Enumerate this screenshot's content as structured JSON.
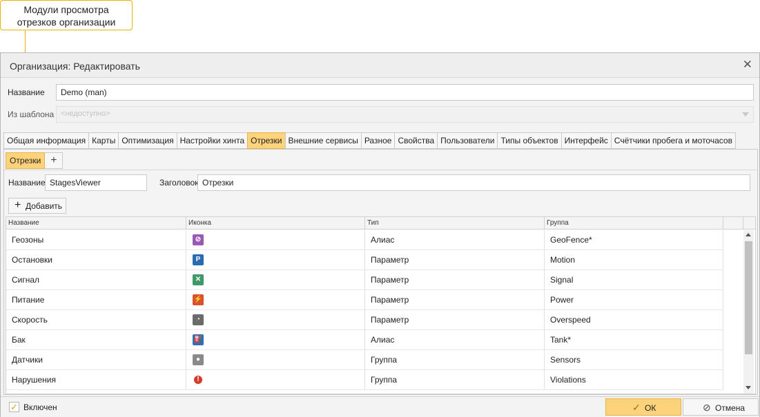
{
  "callout": {
    "text_line1": "Модули просмотра",
    "text_line2": "отрезков организации"
  },
  "dialog": {
    "title": "Организация: Редактировать",
    "name_label": "Название",
    "name_value": "Demo (man)",
    "template_label": "Из шаблона",
    "template_value": "<недоступно>"
  },
  "tabs": [
    "Общая информация",
    "Карты",
    "Оптимизация",
    "Настройки хинта",
    "Отрезки",
    "Внешние сервисы",
    "Разное",
    "Свойства",
    "Пользователи",
    "Типы объектов",
    "Интерфейс",
    "Счётчики пробега и моточасов"
  ],
  "active_tab": "Отрезки",
  "subtabs": {
    "active": "Отрезки",
    "add": "+"
  },
  "segment": {
    "name_label": "Название",
    "name_value": "StagesViewer",
    "header_label": "Заголовок",
    "header_value": "Отрезки"
  },
  "toolbar": {
    "add_label": "Добавить",
    "add_icon": "+"
  },
  "grid": {
    "columns": [
      "Название",
      "Иконка",
      "Тип",
      "Группа"
    ],
    "rows": [
      {
        "name": "Геозоны",
        "icon": "geofence-icon",
        "icon_color": "#9b59b6",
        "icon_glyph": "⊘",
        "type": "Алиас",
        "group": "GeoFence*"
      },
      {
        "name": "Остановки",
        "icon": "parking-icon",
        "icon_color": "#2b6cb0",
        "icon_glyph": "P",
        "type": "Параметр",
        "group": "Motion"
      },
      {
        "name": "Сигнал",
        "icon": "signal-icon",
        "icon_color": "#3f9a67",
        "icon_glyph": "✕",
        "type": "Параметр",
        "group": "Signal"
      },
      {
        "name": "Питание",
        "icon": "power-plug-icon",
        "icon_color": "#d9532c",
        "icon_glyph": "⚡",
        "type": "Параметр",
        "group": "Power"
      },
      {
        "name": "Скорость",
        "icon": "speedometer-icon",
        "icon_color": "#6b6b6b",
        "icon_glyph": "◔",
        "type": "Параметр",
        "group": "Overspeed"
      },
      {
        "name": "Бак",
        "icon": "fuel-tank-icon",
        "icon_color": "#2f6fb3",
        "icon_glyph": "⛽",
        "type": "Алиас",
        "group": "Tank*"
      },
      {
        "name": "Датчики",
        "icon": "sensor-bulb-icon",
        "icon_color": "#8a8a8a",
        "icon_glyph": "●",
        "type": "Группа",
        "group": "Sensors"
      },
      {
        "name": "Нарушения",
        "icon": "violation-icon",
        "icon_color": "#d63a2a",
        "icon_glyph": "!",
        "type": "Группа",
        "group": "Violations"
      }
    ]
  },
  "footer": {
    "enabled_label": "Включен",
    "enabled_checked": true,
    "ok_label": "ОК",
    "cancel_label": "Отмена"
  }
}
